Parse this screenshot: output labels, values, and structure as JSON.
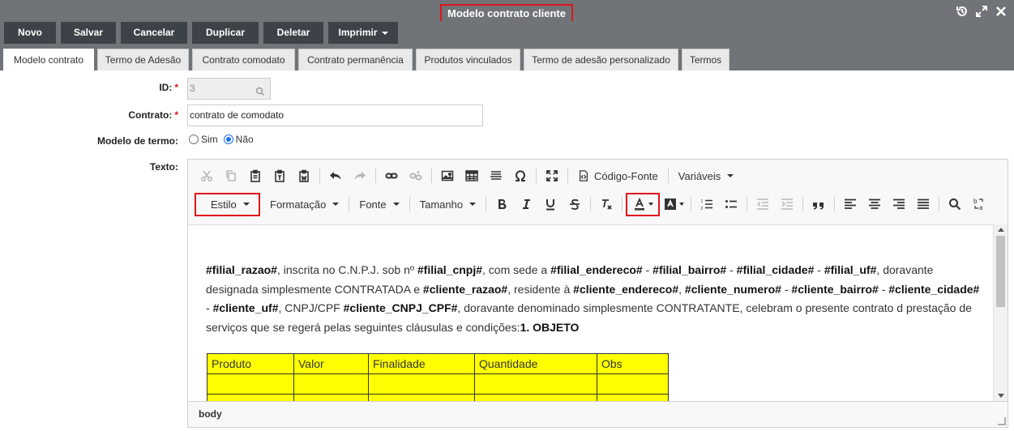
{
  "window": {
    "title": "Modelo contrato cliente"
  },
  "toolbar": {
    "buttons": [
      "Novo",
      "Salvar",
      "Cancelar",
      "Duplicar",
      "Deletar",
      "Imprimir"
    ]
  },
  "tabs": [
    "Modelo contrato",
    "Termo de Adesão",
    "Contrato comodato",
    "Contrato permanência",
    "Produtos vinculados",
    "Termo de adesão personalizado",
    "Termos"
  ],
  "form": {
    "id_label": "ID:",
    "id_value": "3",
    "contrato_label": "Contrato:",
    "contrato_value": "contrato de comodato",
    "modelo_label": "Modelo de termo:",
    "sim_label": "Sim",
    "nao_label": "Não",
    "texto_label": "Texto:",
    "required_mark": "*"
  },
  "editor": {
    "codigo_fonte": "Código-Fonte",
    "variaveis": "Variáveis",
    "estilo": "Estilo",
    "formatacao": "Formatação",
    "fonte": "Fonte",
    "tamanho": "Tamanho",
    "status_path": "body",
    "content_segments": [
      {
        "t": "#filial_razao#",
        "b": true
      },
      {
        "t": ", inscrita no C.N.P.J. sob nº ",
        "b": false
      },
      {
        "t": "#filial_cnpj#",
        "b": true
      },
      {
        "t": ", com sede a ",
        "b": false
      },
      {
        "t": "#filial_endereco#",
        "b": true
      },
      {
        "t": " - ",
        "b": false
      },
      {
        "t": "#filial_bairro#",
        "b": true
      },
      {
        "t": " - ",
        "b": false
      },
      {
        "t": "#filial_cidade#",
        "b": true
      },
      {
        "t": " - ",
        "b": false
      },
      {
        "t": "#filial_uf#",
        "b": true
      },
      {
        "t": ", doravante designada simplesmente CONTRATADA e ",
        "b": false
      },
      {
        "t": "#cliente_razao#",
        "b": true
      },
      {
        "t": ", residente à ",
        "b": false
      },
      {
        "t": "#cliente_endereco#",
        "b": true
      },
      {
        "t": ", ",
        "b": false
      },
      {
        "t": "#cliente_numero#",
        "b": true
      },
      {
        "t": " - ",
        "b": false
      },
      {
        "t": "#cliente_bairro#",
        "b": true
      },
      {
        "t": " - ",
        "b": false
      },
      {
        "t": "#cliente_cidade#",
        "b": true
      },
      {
        "t": " - ",
        "b": false
      },
      {
        "t": "#cliente_uf#",
        "b": true
      },
      {
        "t": ", CNPJ/CPF ",
        "b": false
      },
      {
        "t": "#cliente_CNPJ_CPF#",
        "b": true
      },
      {
        "t": ", doravante denominado simplesmente CONTRATANTE, celebram o presente contrato d prestação de serviços que se regerá pelas seguintes cláusulas e condições:",
        "b": false
      },
      {
        "t": "1. OBJETO",
        "b": true
      }
    ],
    "table_headers": [
      "Produto",
      "Valor",
      "Finalidade",
      "Quantidade",
      "Obs"
    ]
  }
}
